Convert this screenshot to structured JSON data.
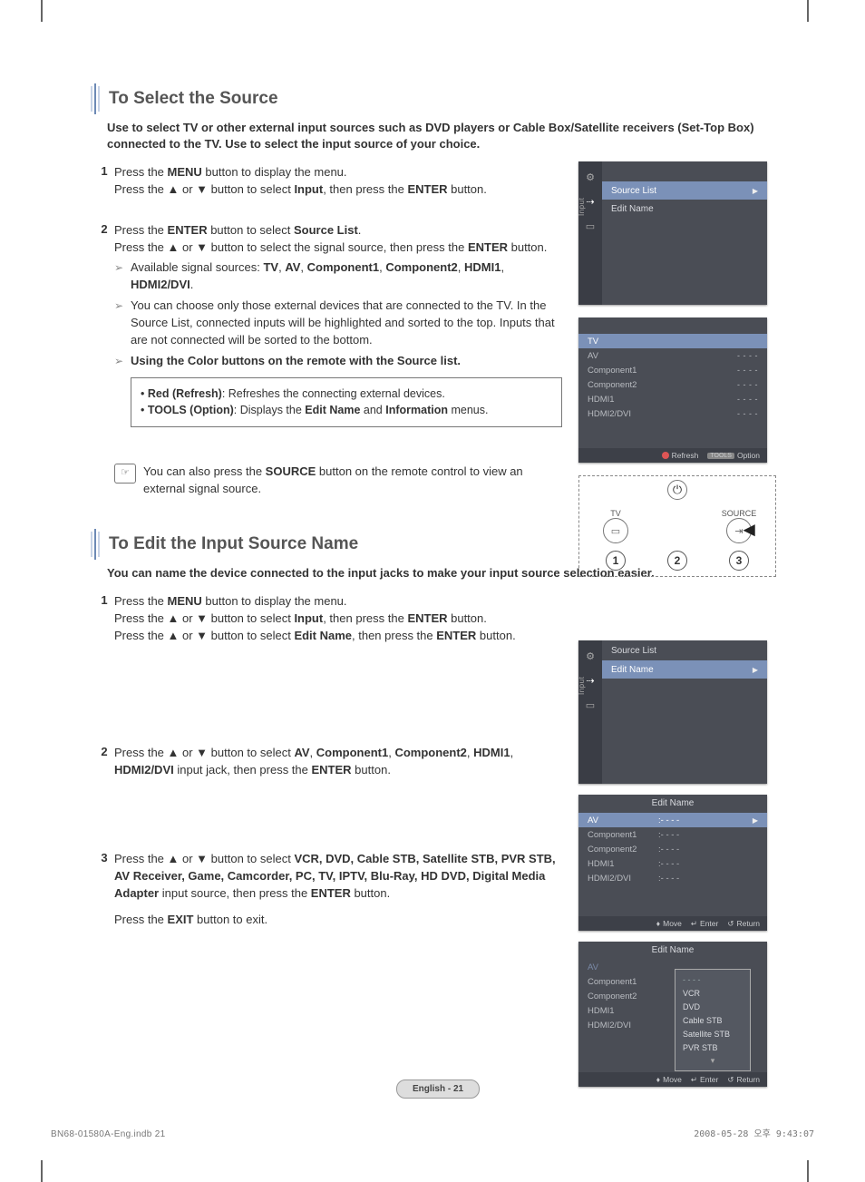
{
  "section1": {
    "title": "To Select the Source",
    "intro": "Use to select TV or other external input sources such as DVD players or Cable Box/Satellite receivers (Set-Top Box) connected to the TV. Use to select the input source of your choice.",
    "step1a": "Press the ",
    "step1b": " button to display the menu.",
    "step1c": "Press the ▲ or ▼ button to select ",
    "step1d": ", then press the ",
    "step1e": " button.",
    "word_menu": "MENU",
    "word_input": "Input",
    "word_enter": "ENTER",
    "step2a": "Press the ",
    "step2b": " button to select ",
    "step2c": "Source List",
    "step2d": ".",
    "step2e": "Press the ▲ or ▼ button to select the signal source, then press the ",
    "step2f": " button.",
    "arrow1a": "Available signal sources: ",
    "arrow1b": "TV",
    "arrow1c": ", ",
    "arrow1d": "AV",
    "arrow1e": "Component1",
    "arrow1f": "Component2",
    "arrow1g": "HDMI1",
    "arrow1h": "HDMI2/DVI",
    "arrow2": "You can choose only those external devices that are connected to the TV. In the Source List, connected inputs will be highlighted and sorted to the top. Inputs that are not connected will be sorted to the bottom.",
    "arrow3": "Using the Color buttons on the remote with the Source list.",
    "box_a": "Red (Refresh)",
    "box_a_txt": ": Refreshes the connecting external devices.",
    "box_b": "TOOLS (Option)",
    "box_b_txt": ": Displays the ",
    "box_b_name1": "Edit Name",
    "box_b_mid": " and ",
    "box_b_name2": "Information",
    "box_b_end": " menus.",
    "hand": "You can also press the ",
    "hand_b": "SOURCE",
    "hand_end": " button on the remote control to view an external signal source."
  },
  "section2": {
    "title": "To Edit the Input Source Name",
    "intro": "You can name the device connected to the input jacks to make your input source selection easier.",
    "step1a": "Press the ",
    "step1b": " button to display the menu.",
    "step1c": "Press the ▲ or ▼ button to select ",
    "step1d": ", then press the ",
    "step1e": " button.",
    "step1f": "Press the ▲ or ▼ button to select ",
    "step1g": "Edit Name",
    "step1h": ", then press the ",
    "step1i": " button.",
    "step2a": "Press the ▲ or ▼ button to select ",
    "step2b": "AV",
    "step2c": "Component1",
    "step2d": "Component2",
    "step2e": "HDMI1",
    "step2f": "HDMI2/DVI",
    "step2g": " input jack, then press the ",
    "step2h": " button.",
    "step3a": "Press the ▲ or ▼ button to select ",
    "step3b": "VCR, DVD, Cable STB, Satellite STB, PVR STB, AV Receiver, Game, Camcorder, PC, TV, IPTV, Blu-Ray, HD DVD, Digital Media Adapter",
    "step3c": " input source, then press the ",
    "step3d": " button.",
    "step3_exit_a": "Press the ",
    "step3_exit_b": "EXIT",
    "step3_exit_c": " button to exit."
  },
  "osd": {
    "input_label": "Input",
    "source_list": "Source List",
    "edit_name": "Edit Name",
    "tv": "TV",
    "av": "AV",
    "c1": "Component1",
    "c2": "Component2",
    "h1": "HDMI1",
    "h2": "HDMI2/DVI",
    "dashes": "- - - -",
    "refresh": "Refresh",
    "option": "Option",
    "move": "Move",
    "enter": "Enter",
    "return": "Return",
    "vcr": "VCR",
    "dvd": "DVD",
    "cstb": "Cable STB",
    "sstb": "Satellite STB",
    "pstb": "PVR STB"
  },
  "remote": {
    "power": "⏻",
    "tv": "TV",
    "source": "SOURCE",
    "n1": "1",
    "n2": "2",
    "n3": "3"
  },
  "footer": {
    "page": "English - 21",
    "meta_left": "BN68-01580A-Eng.indb   21",
    "meta_right": "2008-05-28   오후 9:43:07"
  }
}
